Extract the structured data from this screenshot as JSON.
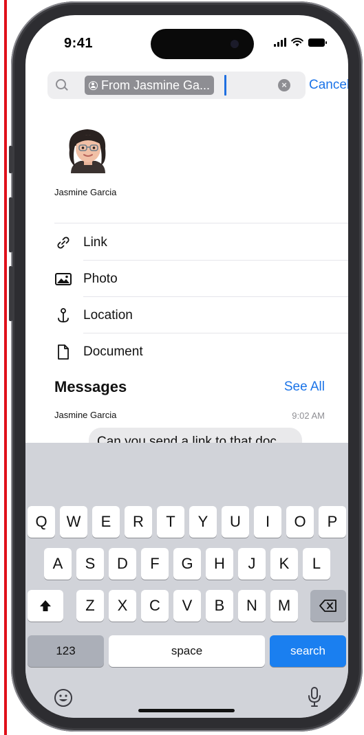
{
  "status_bar": {
    "time": "9:41"
  },
  "search": {
    "token_label": "From Jasmine Ga...",
    "cancel_label": "Cancel"
  },
  "contact": {
    "name": "Jasmine Garcia"
  },
  "categories": [
    {
      "label": "Link",
      "icon": "link-icon"
    },
    {
      "label": "Photo",
      "icon": "photo-icon"
    },
    {
      "label": "Location",
      "icon": "location-pin-icon"
    },
    {
      "label": "Document",
      "icon": "document-icon"
    }
  ],
  "messages": {
    "title": "Messages",
    "see_all_label": "See All",
    "items": [
      {
        "from": "Jasmine Garcia",
        "time": "9:02 AM",
        "text": "Can you send a link to that doc"
      }
    ]
  },
  "keyboard": {
    "row1": [
      "Q",
      "W",
      "E",
      "R",
      "T",
      "Y",
      "U",
      "I",
      "O",
      "P"
    ],
    "row2": [
      "A",
      "S",
      "D",
      "F",
      "G",
      "H",
      "J",
      "K",
      "L"
    ],
    "row3": [
      "Z",
      "X",
      "C",
      "V",
      "B",
      "N",
      "M"
    ],
    "num_label": "123",
    "space_label": "space",
    "search_label": "search"
  },
  "colors": {
    "accent": "#1a73e8",
    "search_key": "#1a7ff0",
    "annotation_line": "#e0101a"
  }
}
